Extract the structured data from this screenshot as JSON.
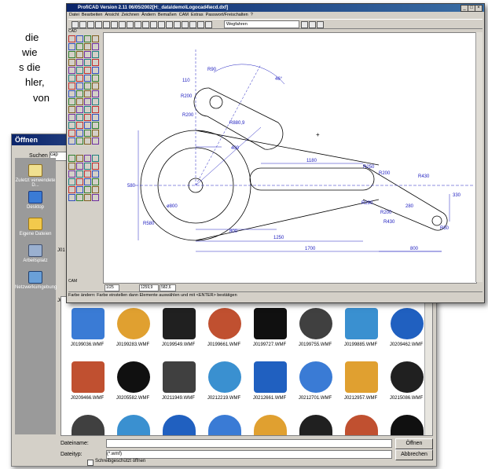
{
  "background_text": [
    "die",
    "wie",
    "s die",
    "hler,",
    "von"
  ],
  "open_dialog": {
    "title": "Öffnen",
    "look_in_label": "Suchen in:",
    "look_in_value": "cap",
    "places": [
      "Zuletzt verwendete D...",
      "Desktop",
      "Eigene Dateien",
      "Arbeitsplatz",
      "Netzwerkumgebung"
    ],
    "side_labels": [
      "J01",
      "J01"
    ],
    "row1": [
      "J0199036.WMF",
      "J0199283.WMF",
      "J0199549.WMF",
      "J0199661.WMF",
      "J0199727.WMF",
      "J0199755.WMF",
      "J0199885.WMF",
      "J0209462.WMF"
    ],
    "row2": [
      "J0209466.WMF",
      "J0205582.WMF",
      "J0211949.WMF",
      "J0212219.WMF",
      "J0212661.WMF",
      "J0212701.WMF",
      "J0212957.WMF",
      "J0215086.WMF"
    ],
    "filename_label": "Dateiname:",
    "filename_value": "",
    "filetype_label": "Dateityp:",
    "filetype_value": "(*.wmf)",
    "readonly_label": "Schreibgeschützt öffnen",
    "open_button": "Öffnen",
    "cancel_button": "Abbrechen"
  },
  "cad": {
    "title": "ProfiCAD Version 2.11 06/05/2002[H:_data\\demo\\Logocad4\\ecd.dxf]",
    "menu": [
      "Datei",
      "Bearbeiten",
      "Ansicht",
      "Zeichnen",
      "Ändern",
      "Bemaßen",
      "CAM",
      "Extras",
      "Passwort/Freischalten",
      "?"
    ],
    "toolbar_layer": "Wegfahren",
    "palette_label_top": "CAD",
    "palette_label_bottom": "CAM",
    "status_text": "Farbe ändern: Farbe einstellen dann Elemente auswählen und mit <ENTER> bestätigen",
    "coord_x": "1259,9",
    "coord_y": "582,6",
    "page_info": "1/25",
    "drawing_labels": {
      "r90": "R90",
      "d110": "110",
      "r200a": "R200",
      "r200b": "R200",
      "r880": "R880,9",
      "a46": "46°",
      "d580": "580",
      "d400": "400",
      "d1180": "1180",
      "r250": "R250",
      "r200c": "R200",
      "r430a": "R430",
      "d330": "330",
      "r290": "R290",
      "r200d": "R200",
      "d280": "280",
      "r430b": "R430",
      "r50": "R50",
      "phi800": "ø800",
      "r580": "R580",
      "d800": "800",
      "d1250": "1250",
      "d1700": "1700",
      "d800b": "800"
    }
  },
  "colors": {
    "title_bar": "#0a246a",
    "dimension": "#2020c0",
    "geometry": "#000000",
    "window_face": "#d4d0c8"
  }
}
